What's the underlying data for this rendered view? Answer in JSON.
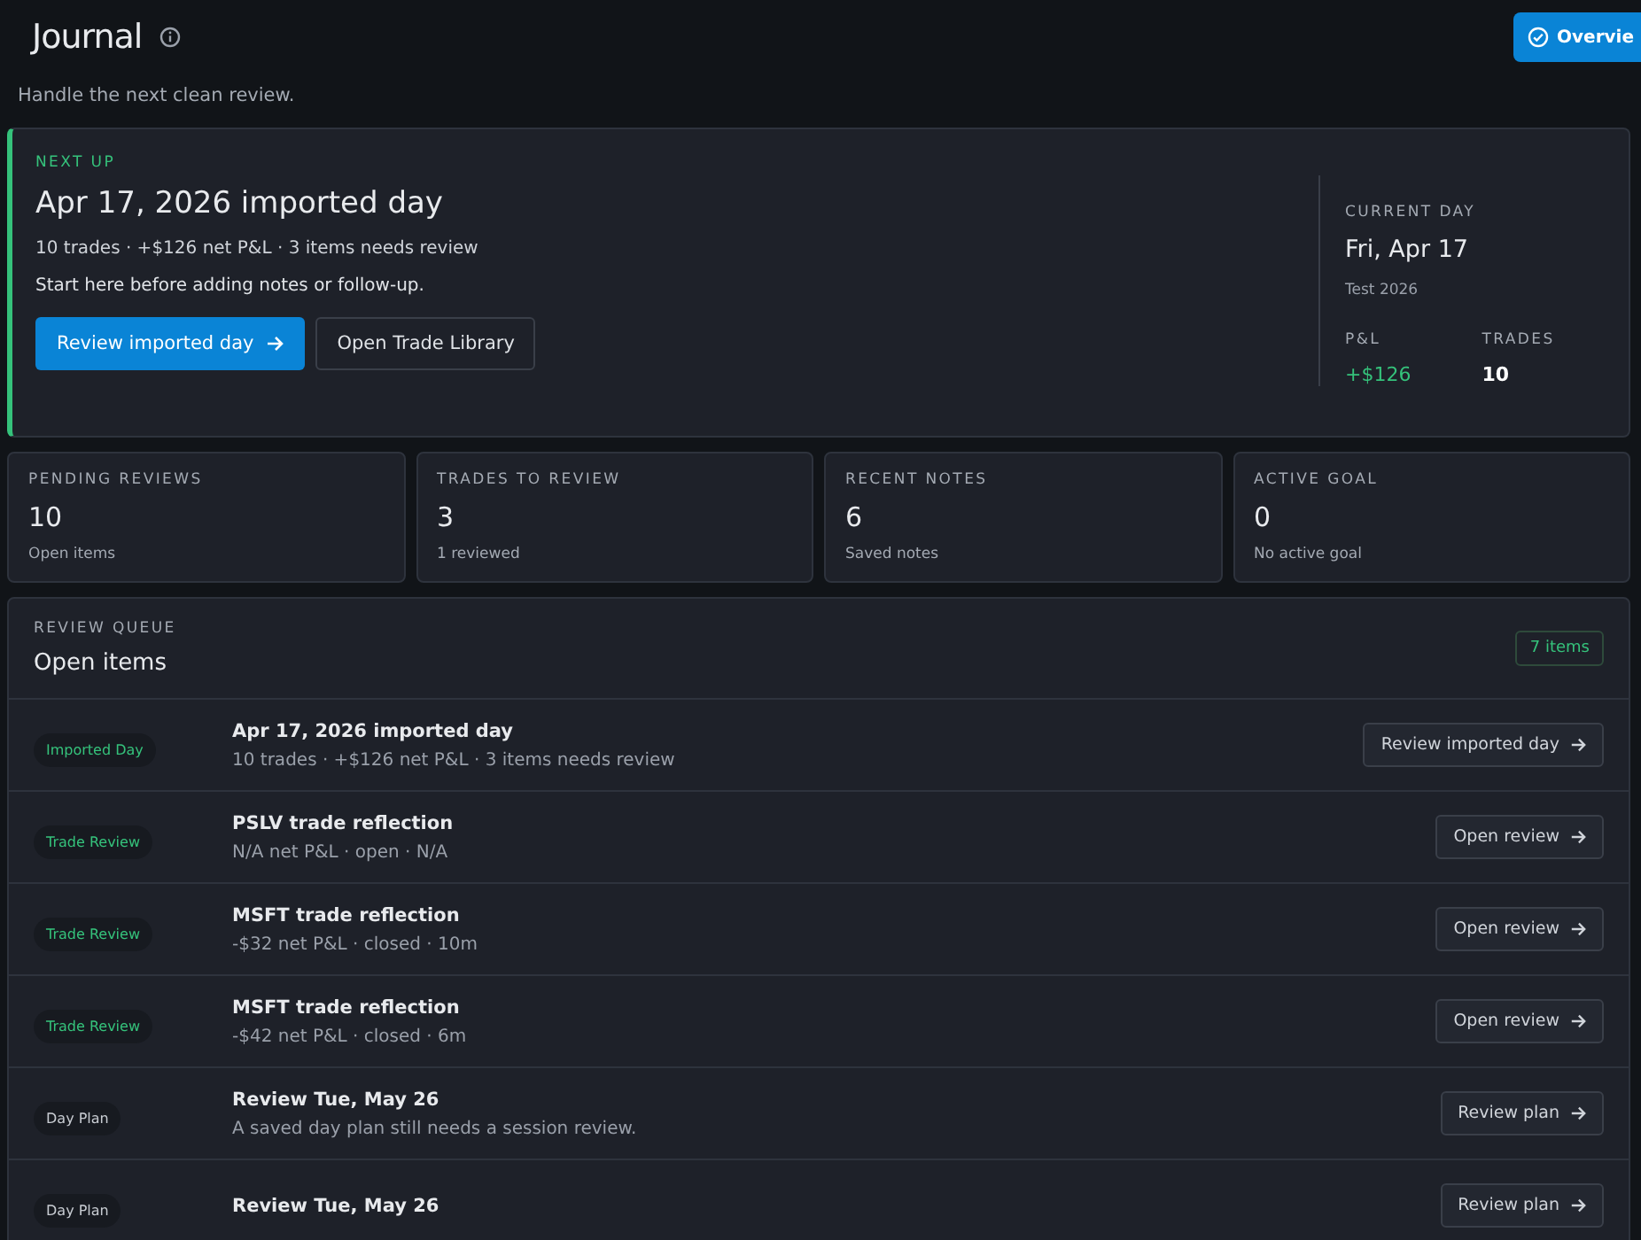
{
  "header": {
    "title": "Journal",
    "subtitle": "Handle the next clean review.",
    "action": "Overvie"
  },
  "next_up": {
    "eyebrow": "NEXT UP",
    "title": "Apr 17, 2026 imported day",
    "meta": "10 trades · +$126 net P&L · 3 items needs review",
    "hint": "Start here before adding notes or follow-up.",
    "primary": "Review imported day",
    "secondary": "Open Trade Library",
    "current_day": {
      "label": "CURRENT DAY",
      "date": "Fri, Apr 17",
      "account": "Test 2026",
      "stats": [
        {
          "label": "P&L",
          "value": "+$126",
          "kind": "gain"
        },
        {
          "label": "TRADES",
          "value": "10",
          "kind": "plain"
        }
      ]
    }
  },
  "summary_cards": [
    {
      "label": "PENDING REVIEWS",
      "value": "10",
      "note": "Open items"
    },
    {
      "label": "TRADES TO REVIEW",
      "value": "3",
      "note": "1 reviewed"
    },
    {
      "label": "RECENT NOTES",
      "value": "6",
      "note": "Saved notes"
    },
    {
      "label": "ACTIVE GOAL",
      "value": "0",
      "note": "No active goal"
    }
  ],
  "queue": {
    "eyebrow": "REVIEW QUEUE",
    "title": "Open items",
    "count": "7 items",
    "rows": [
      {
        "tag": "Imported Day",
        "kind": "imported",
        "title": "Apr 17, 2026 imported day",
        "meta": "10 trades · +$126 net P&L · 3 items needs review",
        "action": "Review imported day"
      },
      {
        "tag": "Trade Review",
        "kind": "trade",
        "title": "PSLV trade reflection",
        "meta": "N/A net P&L · open · N/A",
        "action": "Open review"
      },
      {
        "tag": "Trade Review",
        "kind": "trade",
        "title": "MSFT trade reflection",
        "meta": "-$32 net P&L · closed · 10m",
        "action": "Open review"
      },
      {
        "tag": "Trade Review",
        "kind": "trade",
        "title": "MSFT trade reflection",
        "meta": "-$42 net P&L · closed · 6m",
        "action": "Open review"
      },
      {
        "tag": "Day Plan",
        "kind": "plan",
        "title": "Review Tue, May 26",
        "meta": "A saved day plan still needs a session review.",
        "action": "Review plan"
      },
      {
        "tag": "Day Plan",
        "kind": "plan",
        "title": "Review Tue, May 26",
        "action": "Review plan"
      }
    ]
  }
}
